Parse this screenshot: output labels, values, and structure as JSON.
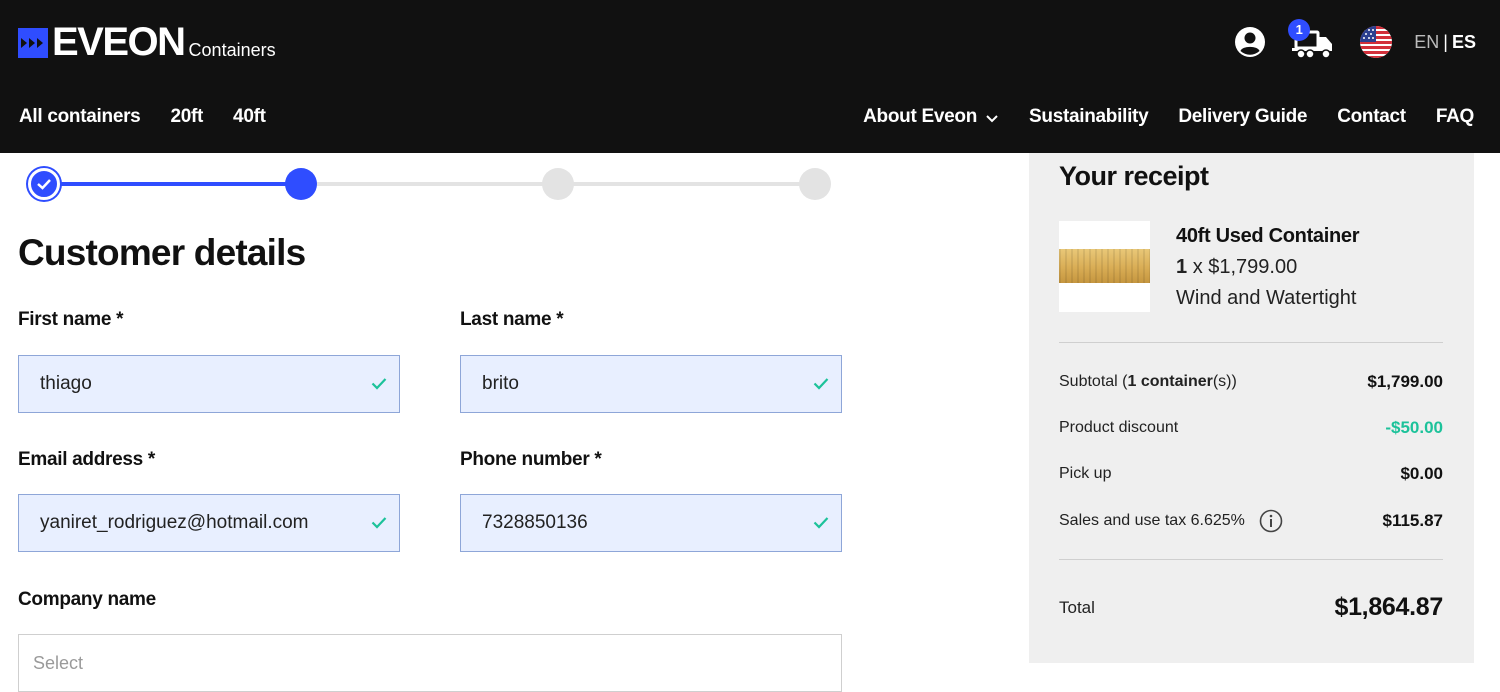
{
  "brand": {
    "name": "EVEON",
    "subtitle": "Containers",
    "accent_color": "#2f4dff"
  },
  "header": {
    "cart_count": "1",
    "icons": [
      "user-icon",
      "truck-cart-icon",
      "us-flag-icon"
    ],
    "lang_en": "EN",
    "lang_sep": "|",
    "lang_es": "ES"
  },
  "nav": {
    "left": [
      "All containers",
      "20ft",
      "40ft"
    ],
    "about": "About Eveon",
    "sustainability": "Sustainability",
    "delivery": "Delivery Guide",
    "contact": "Contact",
    "faq": "FAQ"
  },
  "stepper": {
    "total_steps": 4,
    "current_step": 2,
    "completed_steps": 1
  },
  "form": {
    "title": "Customer details",
    "first_name_label": "First name *",
    "first_name_value": "thiago",
    "last_name_label": "Last name *",
    "last_name_value": "brito",
    "email_label": "Email address *",
    "email_value": "yaniret_rodriguez@hotmail.com",
    "phone_label": "Phone number *",
    "phone_value": "7328850136",
    "company_label": "Company name",
    "company_placeholder": "Select"
  },
  "receipt": {
    "title": "Your receipt",
    "product_name": "40ft Used Container",
    "product_qty": "1",
    "product_qty_sep": "x",
    "product_price": "$1,799.00",
    "product_condition": "Wind and Watertight",
    "subtotal_label_pre": "Subtotal (",
    "subtotal_label_bold": "1 container",
    "subtotal_label_post": "(s))",
    "subtotal_value": "$1,799.00",
    "discount_label": "Product discount",
    "discount_value": "-$50.00",
    "pickup_label": "Pick up",
    "pickup_value": "$0.00",
    "tax_label": "Sales and use tax 6.625%",
    "tax_value": "$115.87",
    "total_label": "Total",
    "total_value": "$1,864.87",
    "discount_color": "#1cc29a"
  }
}
